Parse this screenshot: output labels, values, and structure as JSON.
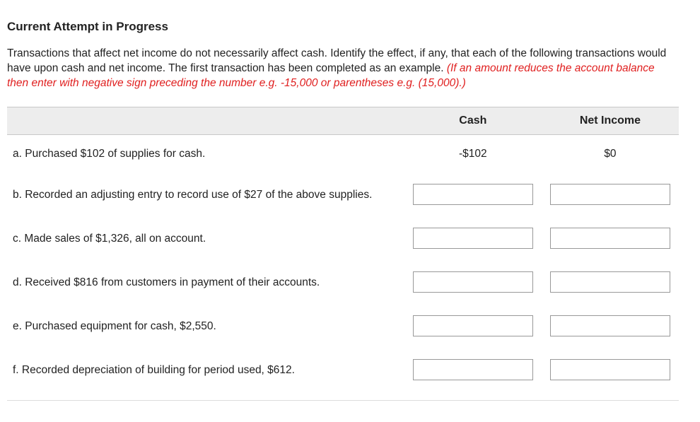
{
  "heading": "Current Attempt in Progress",
  "instructions": {
    "main": "Transactions that affect net income do not necessarily affect cash. Identify the effect, if any, that each of the following transactions would have upon cash and net income. The first transaction has been completed as an example. ",
    "note": "(If an amount reduces the account balance then enter with negative sign preceding the number e.g. -15,000 or parentheses e.g. (15,000).)"
  },
  "columns": {
    "cash": "Cash",
    "net_income": "Net Income"
  },
  "rows": [
    {
      "label": "a. Purchased $102 of supplies for cash.",
      "cash": "-$102",
      "net_income": "$0",
      "editable": false
    },
    {
      "label": "b. Recorded an adjusting entry to record use of $27 of the above supplies.",
      "cash": "",
      "net_income": "",
      "editable": true
    },
    {
      "label": "c. Made sales of $1,326, all on account.",
      "cash": "",
      "net_income": "",
      "editable": true
    },
    {
      "label": "d. Received $816 from customers in payment of their accounts.",
      "cash": "",
      "net_income": "",
      "editable": true
    },
    {
      "label": "e. Purchased equipment for cash, $2,550.",
      "cash": "",
      "net_income": "",
      "editable": true
    },
    {
      "label": "f. Recorded depreciation of building for period used, $612.",
      "cash": "",
      "net_income": "",
      "editable": true
    }
  ]
}
